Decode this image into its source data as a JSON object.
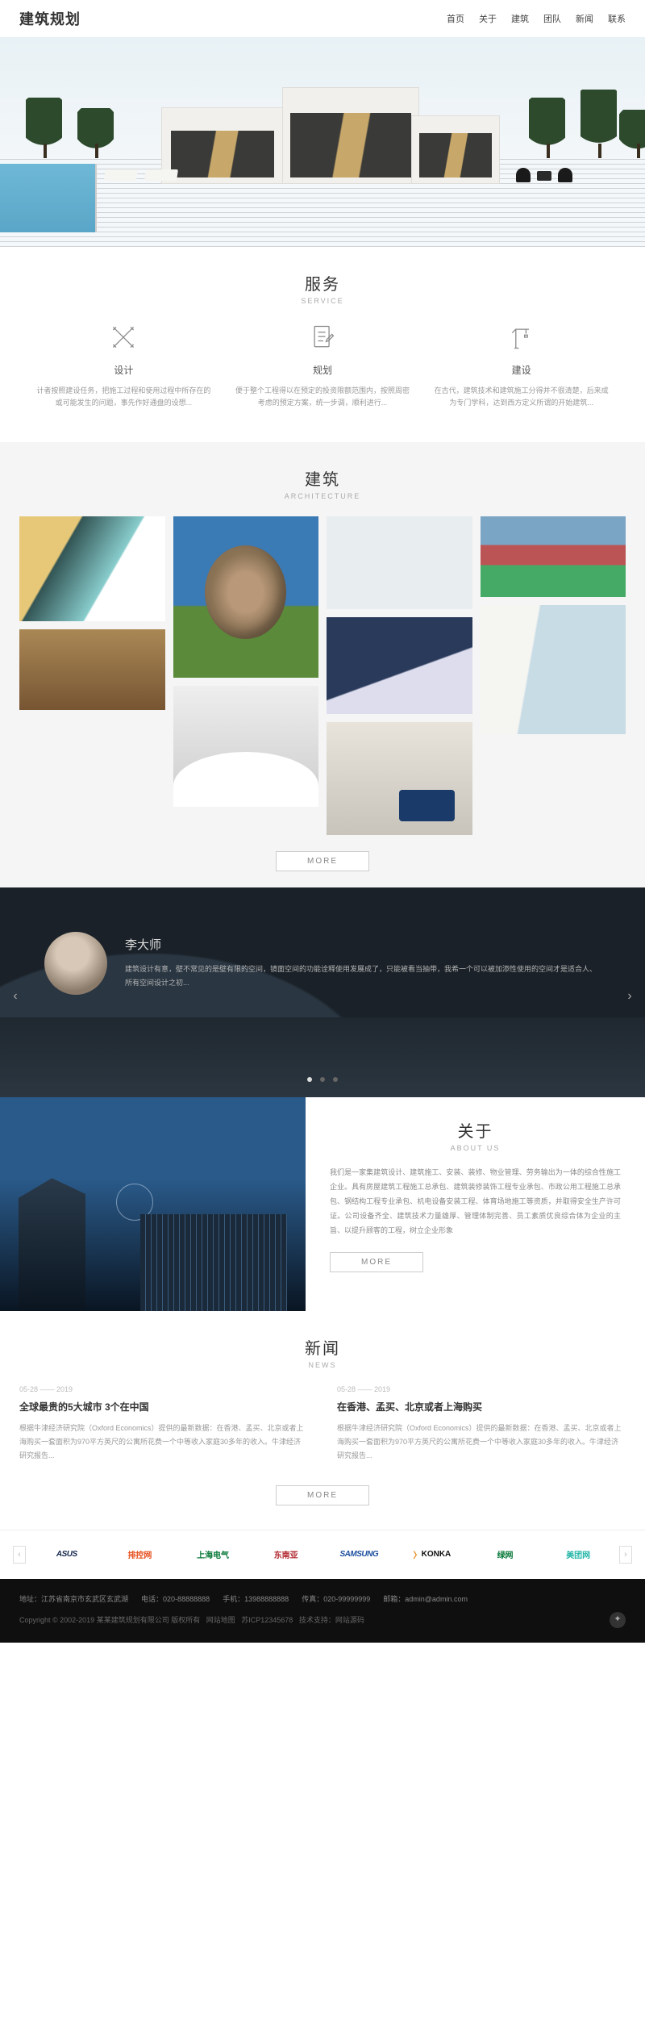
{
  "header": {
    "logo": "建筑规划",
    "nav": [
      "首页",
      "关于",
      "建筑",
      "团队",
      "新闻",
      "联系"
    ]
  },
  "services": {
    "heading_cn": "服务",
    "heading_en": "SERVICE",
    "items": [
      {
        "title": "设计",
        "desc": "计者按照建设任务，把施工过程和使用过程中所存在的或可能发生的问题，事先作好通盘的设想..."
      },
      {
        "title": "规划",
        "desc": "便于整个工程得以在预定的投资限额范围内，按照周密考虑的预定方案，统一步调，顺利进行..."
      },
      {
        "title": "建设",
        "desc": "在古代，建筑技术和建筑施工分得并不很清楚，后来成为专门学科，达到西方定义所谓的开始建筑..."
      }
    ]
  },
  "architecture": {
    "heading_cn": "建筑",
    "heading_en": "ARCHITECTURE",
    "more": "MORE"
  },
  "team": {
    "name": "李大师",
    "desc": "建筑设计有意，壁不常见的是壁有限的空间，镜面空间的功能诠释使用发展成了，只能被看当抽带，我希一个可以被加添性使用的空间才是适合人、所有空间设计之初..."
  },
  "about": {
    "heading_cn": "关于",
    "heading_en": "ABOUT US",
    "desc": "我们是一家集建筑设计、建筑施工、安装、装修、物业管理、劳务输出为一体的综合性施工企业。具有房屋建筑工程施工总承包、建筑装修装饰工程专业承包、市政公用工程施工总承包、钢结构工程专业承包、机电设备安装工程、体育场地施工等资质，并取得安全生产许可证。公司设备齐全、建筑技术力量雄厚、管理体制完善、员工素质优良综合体为企业的主旨、以提升顾客的工程，树立企业形象",
    "more": "MORE"
  },
  "news": {
    "heading_cn": "新闻",
    "heading_en": "NEWS",
    "more": "MORE",
    "items": [
      {
        "date": "05-28 —— 2019",
        "title": "全球最贵的5大城市 3个在中国",
        "desc": "根据牛津经济研究院（Oxford Economics）提供的最新数据：在香港、孟买、北京或者上海购买一套面积为970平方英尺的公寓所花费一个中等收入家庭30多年的收入。牛津经济研究报告..."
      },
      {
        "date": "05-28 —— 2019",
        "title": "在香港、孟买、北京或者上海购买",
        "desc": "根据牛津经济研究院（Oxford Economics）提供的最新数据：在香港、孟买、北京或者上海购买一套面积为970平方英尺的公寓所花费一个中等收入家庭30多年的收入。牛津经济研究报告..."
      }
    ]
  },
  "partners": [
    "ASUS",
    "排控网",
    "上海电气",
    "东南亚",
    "SAMSUNG",
    "KONKA",
    "绿网",
    "美团网"
  ],
  "footer": {
    "contact": {
      "address_label": "地址：",
      "address": "江苏省南京市玄武区玄武湖",
      "tel_label": "电话：",
      "tel": "020-88888888",
      "mobile_label": "手机：",
      "mobile": "13988888888",
      "fax_label": "传真：",
      "fax": "020-99999999",
      "email_label": "邮箱：",
      "email": "admin@admin.com"
    },
    "copyright": "Copyright © 2002-2019 某某建筑规划有限公司 版权所有",
    "sitemap": "网站地图",
    "icp": "苏ICP12345678",
    "support_label": "技术支持：",
    "support": "网站源码"
  }
}
